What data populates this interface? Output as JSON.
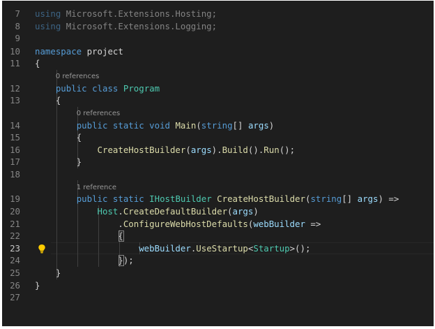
{
  "editor": {
    "active_line": "23",
    "lines": [
      {
        "n": "7",
        "segs": [
          {
            "t": "using",
            "k": "kw"
          },
          {
            "t": " Microsoft.Extensions.Hosting;"
          }
        ],
        "dim": true
      },
      {
        "n": "8",
        "segs": [
          {
            "t": "using",
            "k": "kw"
          },
          {
            "t": " Microsoft.Extensions.Logging;"
          }
        ],
        "dim": true
      },
      {
        "n": "9",
        "segs": []
      },
      {
        "n": "10",
        "segs": [
          {
            "t": "namespace",
            "k": "kw"
          },
          {
            "t": " project"
          }
        ]
      },
      {
        "n": "11",
        "segs": [
          {
            "t": "{"
          }
        ]
      },
      {
        "n": "12",
        "segs": [
          {
            "t": "    "
          },
          {
            "t": "public",
            "k": "kw"
          },
          {
            "t": " "
          },
          {
            "t": "class",
            "k": "kw"
          },
          {
            "t": " "
          },
          {
            "t": "Program",
            "k": "type"
          }
        ],
        "codelens": "0 references"
      },
      {
        "n": "13",
        "segs": [
          {
            "t": "    {"
          }
        ]
      },
      {
        "n": "14",
        "segs": [
          {
            "t": "        "
          },
          {
            "t": "public",
            "k": "kw"
          },
          {
            "t": " "
          },
          {
            "t": "static",
            "k": "kw"
          },
          {
            "t": " "
          },
          {
            "t": "void",
            "k": "kw"
          },
          {
            "t": " "
          },
          {
            "t": "Main",
            "k": "fn"
          },
          {
            "t": "("
          },
          {
            "t": "string",
            "k": "kw"
          },
          {
            "t": "[] "
          },
          {
            "t": "args",
            "k": "par"
          },
          {
            "t": ")"
          }
        ],
        "codelens": "0 references"
      },
      {
        "n": "15",
        "segs": [
          {
            "t": "        {"
          }
        ]
      },
      {
        "n": "16",
        "segs": [
          {
            "t": "            "
          },
          {
            "t": "CreateHostBuilder",
            "k": "fn"
          },
          {
            "t": "("
          },
          {
            "t": "args",
            "k": "par"
          },
          {
            "t": ")."
          },
          {
            "t": "Build",
            "k": "fn"
          },
          {
            "t": "()."
          },
          {
            "t": "Run",
            "k": "fn"
          },
          {
            "t": "();"
          }
        ]
      },
      {
        "n": "17",
        "segs": [
          {
            "t": "        }"
          }
        ]
      },
      {
        "n": "18",
        "segs": []
      },
      {
        "n": "19",
        "segs": [
          {
            "t": "        "
          },
          {
            "t": "public",
            "k": "kw"
          },
          {
            "t": " "
          },
          {
            "t": "static",
            "k": "kw"
          },
          {
            "t": " "
          },
          {
            "t": "IHostBuilder",
            "k": "type"
          },
          {
            "t": " "
          },
          {
            "t": "CreateHostBuilder",
            "k": "fn"
          },
          {
            "t": "("
          },
          {
            "t": "string",
            "k": "kw"
          },
          {
            "t": "[] "
          },
          {
            "t": "args",
            "k": "par"
          },
          {
            "t": ") =>"
          }
        ],
        "codelens": "1 reference"
      },
      {
        "n": "20",
        "segs": [
          {
            "t": "            "
          },
          {
            "t": "Host",
            "k": "type"
          },
          {
            "t": "."
          },
          {
            "t": "CreateDefaultBuilder",
            "k": "fn"
          },
          {
            "t": "("
          },
          {
            "t": "args",
            "k": "par"
          },
          {
            "t": ")"
          }
        ]
      },
      {
        "n": "21",
        "segs": [
          {
            "t": "                ."
          },
          {
            "t": "ConfigureWebHostDefaults",
            "k": "fn"
          },
          {
            "t": "("
          },
          {
            "t": "webBuilder",
            "k": "par"
          },
          {
            "t": " =>"
          }
        ]
      },
      {
        "n": "22",
        "segs": [
          {
            "t": "                {"
          }
        ]
      },
      {
        "n": "23",
        "segs": [
          {
            "t": "                    "
          },
          {
            "t": "webBuilder",
            "k": "par"
          },
          {
            "t": "."
          },
          {
            "t": "UseStartup",
            "k": "fn"
          },
          {
            "t": "<"
          },
          {
            "t": "Startup",
            "k": "type"
          },
          {
            "t": ">();"
          }
        ]
      },
      {
        "n": "24",
        "segs": [
          {
            "t": "                });"
          }
        ]
      },
      {
        "n": "25",
        "segs": [
          {
            "t": "    }"
          }
        ]
      },
      {
        "n": "26",
        "segs": [
          {
            "t": "}"
          }
        ]
      },
      {
        "n": "27",
        "segs": []
      }
    ],
    "colors": {
      "background": "#1e1e1e",
      "keyword": "#569cd6",
      "type": "#4ec9b0",
      "function": "#dcdcaa",
      "parameter": "#9cdcfe",
      "text": "#d4d4d4",
      "line_number": "#858585",
      "lightbulb": "#ffcc00"
    },
    "icons": {
      "gutter": "lightbulb-icon"
    }
  }
}
